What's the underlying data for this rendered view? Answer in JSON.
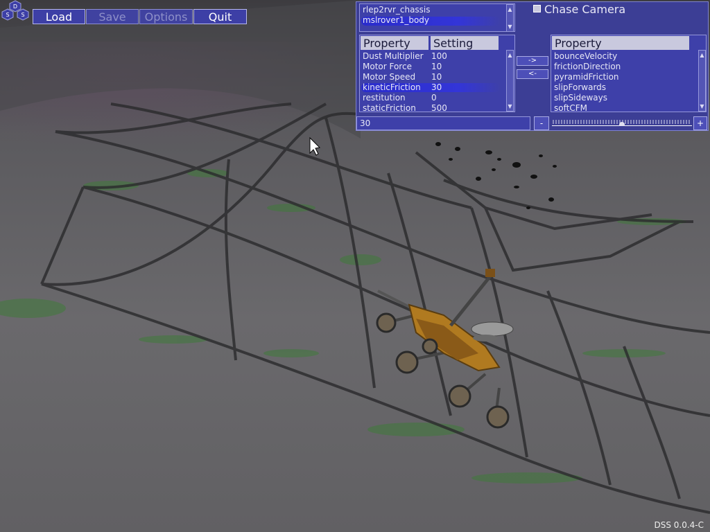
{
  "app": {
    "logo_letters": [
      "D",
      "S",
      "S"
    ],
    "version": "DSS 0.0.4-C"
  },
  "menu": {
    "load": "Load",
    "save": "Save",
    "options": "Options",
    "quit": "Quit"
  },
  "object_list": {
    "items": [
      "rlep2rvr_chassis",
      "mslrover1_body"
    ],
    "selected": "mslrover1_body"
  },
  "chase_camera": {
    "label": "Chase Camera",
    "checked": false
  },
  "property_table": {
    "col_property": "Property",
    "col_setting": "Setting",
    "rows": [
      {
        "property": "Dust Multiplier",
        "setting": "100"
      },
      {
        "property": "Motor Force",
        "setting": "10"
      },
      {
        "property": "Motor Speed",
        "setting": "10"
      },
      {
        "property": "kineticFriction",
        "setting": "30"
      },
      {
        "property": "restitution",
        "setting": "0"
      },
      {
        "property": "staticFriction",
        "setting": "500"
      }
    ],
    "selected": "kineticFriction"
  },
  "transfer": {
    "add_label": "->",
    "remove_label": "<-"
  },
  "available_properties": {
    "col_property": "Property",
    "items": [
      "bounceVelocity",
      "frictionDirection",
      "pyramidFriction",
      "slipForwards",
      "slipSideways",
      "softCFM"
    ]
  },
  "value_editor": {
    "value": "30",
    "minus_label": "-",
    "plus_label": "+",
    "slider_fraction": 0.5
  },
  "colors": {
    "panel": "#3c3e95",
    "selection": "#2a2ccc",
    "header": "#c9c9de",
    "terrain": "#5a5a5c",
    "grid": "#2c2c2c",
    "moss": "#3f7a3a",
    "rover_body": "#b07a20"
  },
  "icons": {
    "cursor": "arrow-cursor-icon",
    "scroll_up": "chevron-up-icon",
    "scroll_down": "chevron-down-icon"
  }
}
